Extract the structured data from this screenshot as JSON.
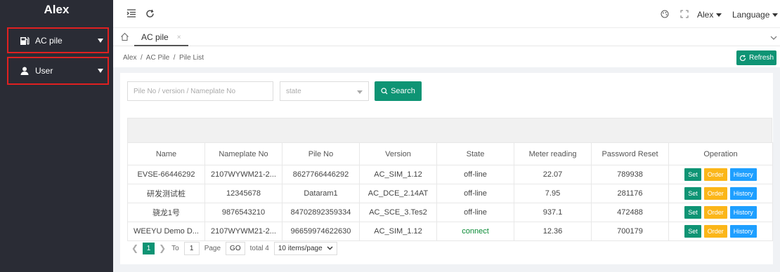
{
  "app": {
    "title": "Alex"
  },
  "sidebar": {
    "items": [
      {
        "label": "AC pile",
        "icon": "charging-pile-icon"
      },
      {
        "label": "User",
        "icon": "user-icon"
      }
    ]
  },
  "header": {
    "user_label": "Alex",
    "language_label": "Language"
  },
  "tabs": {
    "active_label": "AC pile",
    "close_glyph": "×"
  },
  "breadcrumb": {
    "text": "Alex  /  AC Pile  /  Pile List"
  },
  "toolbar": {
    "refresh_label": "Refresh"
  },
  "search": {
    "input_placeholder": "Pile No / version / Nameplate No",
    "input_value": "",
    "state_placeholder": "state",
    "button_label": "Search"
  },
  "table": {
    "columns": [
      "Name",
      "Nameplate No",
      "Pile No",
      "Version",
      "State",
      "Meter reading",
      "Password Reset",
      "Operation"
    ],
    "rows": [
      {
        "name": "EVSE-66446292",
        "nameplate": "2107WYWM21-2...",
        "pile_no": "8627766446292",
        "version": "AC_SIM_1.12",
        "state": "off-line",
        "meter": "22.07",
        "password": "789938"
      },
      {
        "name": "研发测试桩",
        "nameplate": "12345678",
        "pile_no": "Dataram1",
        "version": "AC_DCE_2.14AT",
        "state": "off-line",
        "meter": "7.95",
        "password": "281176"
      },
      {
        "name": "骁龙1号",
        "nameplate": "9876543210",
        "pile_no": "84702892359334",
        "version": "AC_SCE_3.Tes2",
        "state": "off-line",
        "meter": "937.1",
        "password": "472488"
      },
      {
        "name": "WEEYU Demo D...",
        "nameplate": "2107WYWM21-2...",
        "pile_no": "96659974622630",
        "version": "AC_SIM_1.12",
        "state": "connect",
        "meter": "12.36",
        "password": "700179"
      }
    ],
    "op_labels": {
      "set": "Set",
      "order": "Order",
      "history": "History"
    }
  },
  "pagination": {
    "current_page": "1",
    "to_label": "To",
    "goto_value": "1",
    "page_label": "Page",
    "go_label": "GO",
    "total_label": "total 4",
    "page_size_label": "10 items/page"
  },
  "colors": {
    "sidebar_bg": "#2a2c35",
    "accent": "#0e9474",
    "order": "#fbb619",
    "history": "#1e9fff",
    "connect": "#0a8a35",
    "highlight_border": "#e02020"
  }
}
